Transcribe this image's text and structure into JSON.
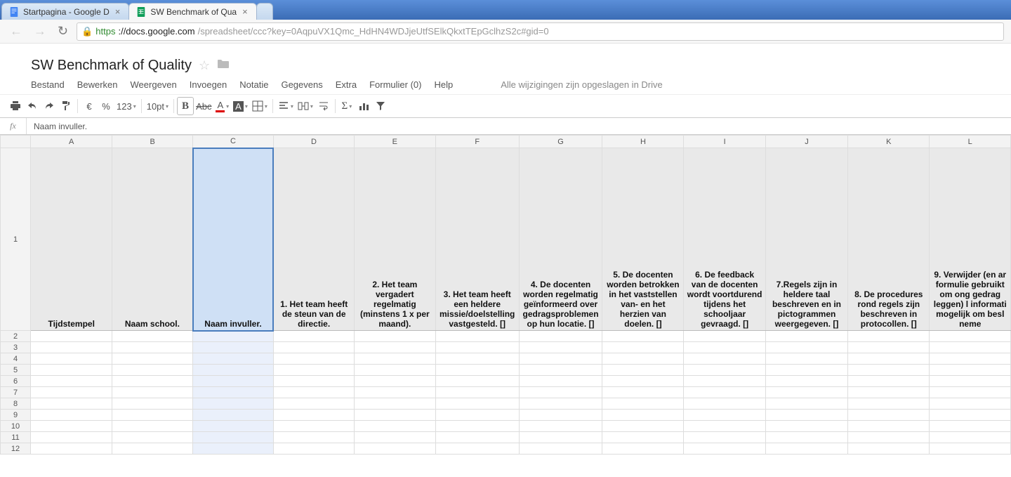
{
  "browser": {
    "tabs": [
      {
        "title": "Startpagina - Google D",
        "active": false,
        "favicon": "docs"
      },
      {
        "title": "SW Benchmark of Qua",
        "active": true,
        "favicon": "sheets"
      }
    ],
    "url_proto": "https",
    "url_host": "://docs.google.com",
    "url_path": "/spreadsheet/ccc?key=0AqpuVX1Qmc_HdHN4WDJjeUtfSElkQkxtTEpGclhzS2c#gid=0"
  },
  "doc": {
    "title": "SW Benchmark of Quality",
    "menu": {
      "file": "Bestand",
      "edit": "Bewerken",
      "view": "Weergeven",
      "insert": "Invoegen",
      "format": "Notatie",
      "data": "Gegevens",
      "extra": "Extra",
      "form": "Formulier (0)",
      "help": "Help"
    },
    "save_status": "Alle wijzigingen zijn opgeslagen in Drive",
    "toolbar": {
      "currency": "€",
      "percent": "%",
      "numfmt": "123",
      "fontsize": "10pt",
      "bold": "B",
      "strike": "Abc",
      "textcolor": "A",
      "fillcolor": "A"
    },
    "fx_label": "fx",
    "fx_value": "Naam invuller."
  },
  "sheet": {
    "cols": [
      "A",
      "B",
      "C",
      "D",
      "E",
      "F",
      "G",
      "H",
      "I",
      "J",
      "K",
      "L"
    ],
    "selected_col_index": 2,
    "header_row": [
      "Tijdstempel",
      "Naam school.",
      "Naam invuller.",
      "1. Het team heeft de steun van de directie.",
      "2. Het team vergadert regelmatig (minstens 1 x per maand).",
      "3. Het team heeft een heldere missie/doelstelling vastgesteld. []",
      "4. De docenten worden regelmatig geïnformeerd over gedragsproblemen op hun locatie. []",
      "5. De docenten worden betrokken in het vaststellen van- en het herzien van doelen. []",
      "6. De feedback van de docenten wordt voortdurend tijdens het schooljaar gevraagd. []",
      "7.Regels zijn in heldere taal beschreven en in pictogrammen weergegeven. []",
      "8. De procedures rond regels zijn beschreven in protocollen. []",
      "9. Verwijder (en ar formulie gebruikt om ong gedrag leggen) l informati mogelijk om besl neme"
    ],
    "data_rows": 11
  }
}
